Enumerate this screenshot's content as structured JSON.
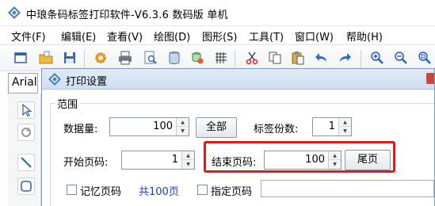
{
  "app": {
    "title": "中琅条码标签打印软件-V6.3.6 数码版 单机"
  },
  "menu": [
    "文件(F)",
    "编辑(E)",
    "查看(V)",
    "绘图(D)",
    "图形(S)",
    "工具(T)",
    "窗口(W)",
    "帮助(H)"
  ],
  "toolbar": {
    "icons": [
      "new-window-icon",
      "open-folder-icon",
      "save-icon",
      "settings-gear-icon",
      "print-icon",
      "print-preview-icon",
      "database-icon",
      "data-sync-icon",
      "grid-icon",
      "cut-icon",
      "copy-icon",
      "paste-icon",
      "undo-icon",
      "redo-icon",
      "zoom-in-icon",
      "zoom-out-icon",
      "zoom-fit-icon"
    ]
  },
  "font_combo": {
    "value": "Arial"
  },
  "dialog": {
    "title": "打印设置",
    "group_label": "范围",
    "data_count_label": "数据量:",
    "data_count_value": "100",
    "all_button": "全部",
    "label_copies_label": "标签份数:",
    "label_copies_value": "1",
    "start_page_label": "开始页码:",
    "start_page_value": "1",
    "end_page_label": "结束页码:",
    "end_page_value": "100",
    "last_page_button": "尾页",
    "remember_page_label": "记忆页码",
    "total_pages_text": "共100页",
    "specify_page_label": "指定页码",
    "specify_page_value": ""
  },
  "colors": {
    "highlight": "#e3191b",
    "link_blue": "#1b3fbf"
  }
}
